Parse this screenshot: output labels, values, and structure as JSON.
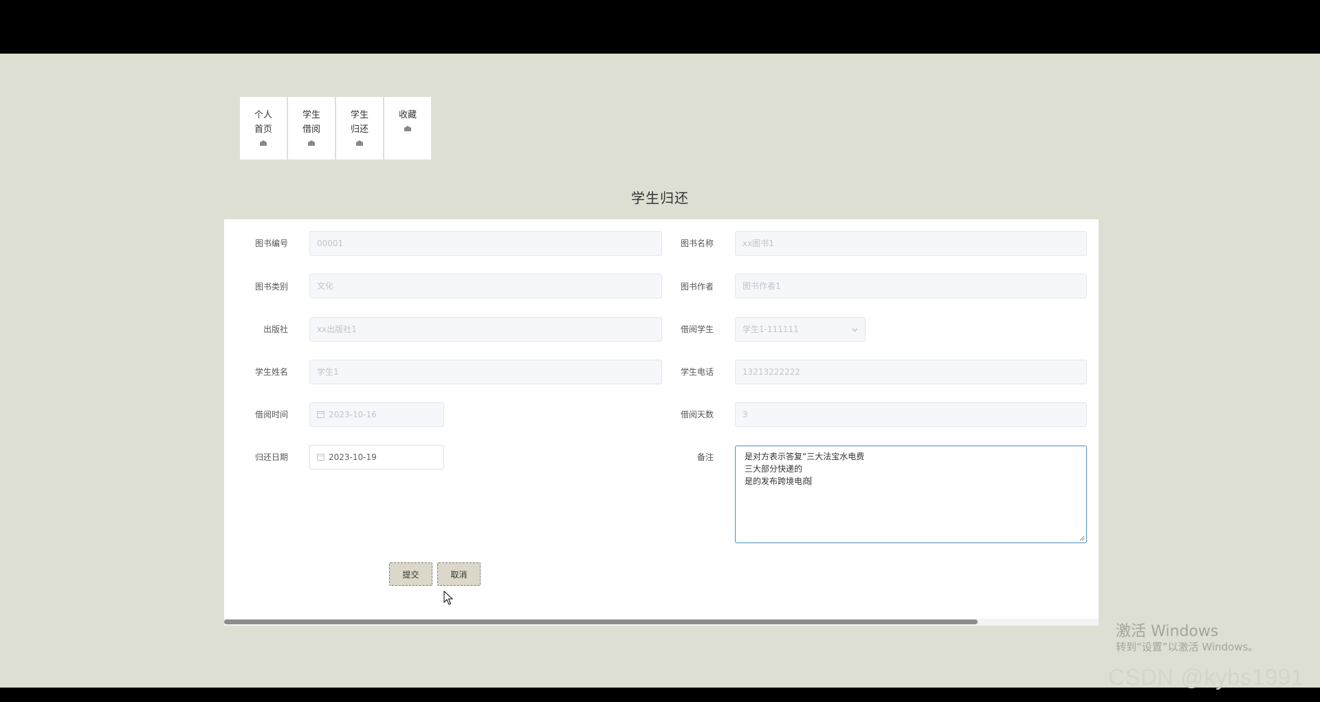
{
  "nav": {
    "items": [
      {
        "lines": [
          "个人",
          "首页"
        ]
      },
      {
        "lines": [
          "学生",
          "借阅"
        ]
      },
      {
        "lines": [
          "学生",
          "归还"
        ]
      },
      {
        "lines": [
          "收藏"
        ]
      }
    ]
  },
  "page_title": "学生归还",
  "form": {
    "book_no": {
      "label": "图书编号",
      "value": "00001"
    },
    "book_name": {
      "label": "图书名称",
      "value": "xx图书1"
    },
    "book_category": {
      "label": "图书类别",
      "value": "文化"
    },
    "book_author": {
      "label": "图书作者",
      "value": "图书作者1"
    },
    "publisher": {
      "label": "出版社",
      "value": "xx出版社1"
    },
    "borrow_student": {
      "label": "借阅学生",
      "value": "学生1-111111"
    },
    "student_name": {
      "label": "学生姓名",
      "value": "学生1"
    },
    "student_phone": {
      "label": "学生电话",
      "value": "13213222222"
    },
    "borrow_time": {
      "label": "借阅时间",
      "value": "2023-10-16"
    },
    "borrow_days": {
      "label": "借阅天数",
      "value": "3"
    },
    "return_date": {
      "label": "归还日期",
      "value": "2023-10-19"
    },
    "remark": {
      "label": "备注",
      "lines": [
        "是对方表示答复“三大法宝水电费",
        "三大部分快递的",
        "是的发布跨境电商"
      ]
    }
  },
  "buttons": {
    "submit": "提交",
    "cancel": "取消"
  },
  "watermark": {
    "line1": "激活 Windows",
    "line2": "转到“设置”以激活 Windows。"
  },
  "credit": "CSDN @kybs1991"
}
